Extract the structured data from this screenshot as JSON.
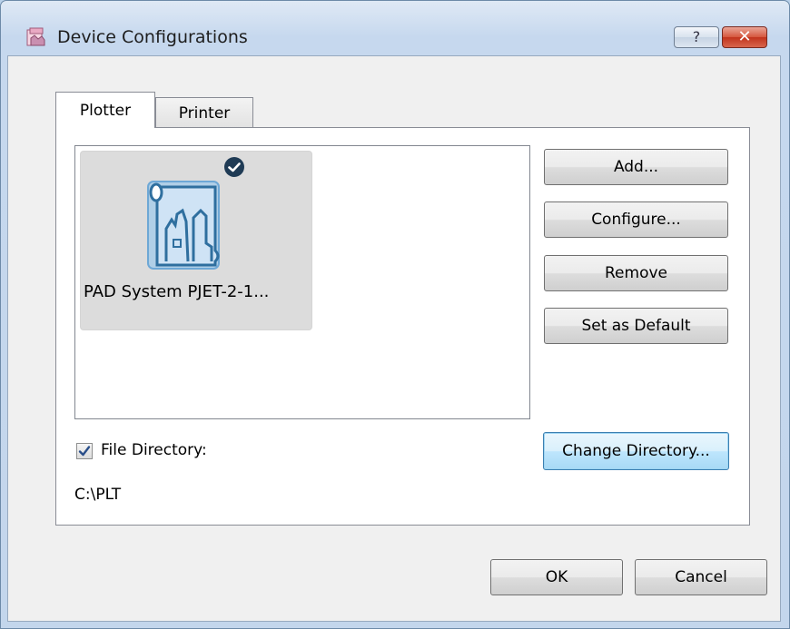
{
  "window": {
    "title": "Device Configurations",
    "help_label": "?",
    "close_label": "✕"
  },
  "tabs": [
    {
      "label": "Plotter",
      "selected": true
    },
    {
      "label": "Printer",
      "selected": false
    }
  ],
  "devices": [
    {
      "name": "PAD System PJET-2-1...",
      "icon": "plotter-icon",
      "is_default": true
    }
  ],
  "actions": {
    "add": "Add...",
    "configure": "Configure...",
    "remove": "Remove",
    "set_default": "Set as Default",
    "change_directory": "Change Directory..."
  },
  "file_directory": {
    "label": "File Directory:",
    "checked": true,
    "path": "C:\\PLT"
  },
  "footer": {
    "ok": "OK",
    "cancel": "Cancel"
  },
  "colors": {
    "accent_blue": "#2f6f9f",
    "window_frame": "#b9d1ea",
    "close_red": "#c1331c"
  }
}
